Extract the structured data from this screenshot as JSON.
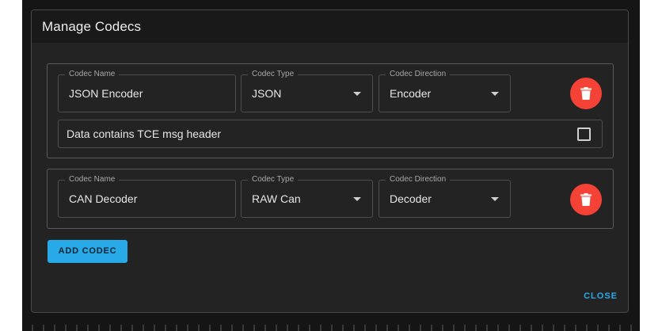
{
  "dialog": {
    "title": "Manage Codecs"
  },
  "codecs": [
    {
      "name_label": "Codec Name",
      "name_value": "JSON Encoder",
      "type_label": "Codec Type",
      "type_value": "JSON",
      "direction_label": "Codec Direction",
      "direction_value": "Encoder",
      "checkbox_label": "Data contains TCE msg header",
      "checkbox_checked": false
    },
    {
      "name_label": "Codec Name",
      "name_value": "CAN Decoder",
      "type_label": "Codec Type",
      "type_value": "RAW Can",
      "direction_label": "Codec Direction",
      "direction_value": "Decoder"
    }
  ],
  "actions": {
    "add_label": "ADD CODEC",
    "close_label": "CLOSE"
  },
  "colors": {
    "accent": "#29aae8",
    "delete": "#f44336"
  },
  "icons": {
    "delete": "trash-icon",
    "dropdown": "chevron-down-icon",
    "checkbox": "checkbox-icon"
  }
}
